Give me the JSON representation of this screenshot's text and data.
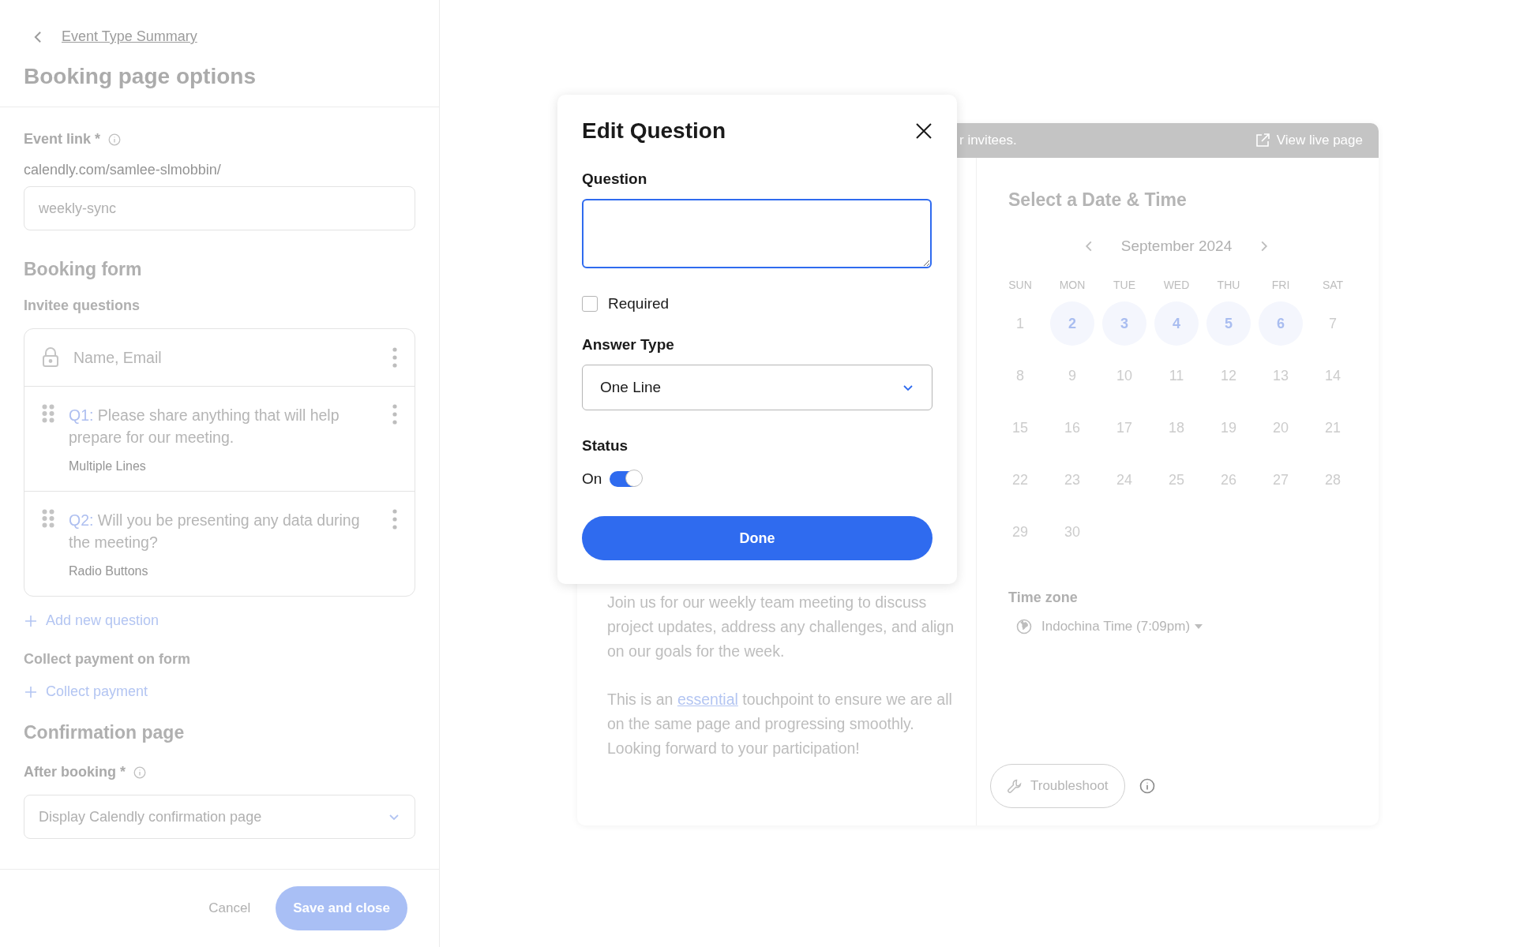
{
  "sidebar": {
    "back_link": "Event Type Summary",
    "title": "Booking page options",
    "event_link": {
      "label": "Event link *",
      "prefix": "calendly.com/samlee-slmobbin/",
      "value": "weekly-sync"
    },
    "booking_form": {
      "title": "Booking form",
      "subtitle": "Invitee questions",
      "questions": [
        {
          "kind": "locked",
          "text": "Name, Email"
        },
        {
          "kind": "custom",
          "number": "Q1:",
          "text": "Please share anything that will help prepare for our meeting.",
          "type": "Multiple Lines"
        },
        {
          "kind": "custom",
          "number": "Q2:",
          "text": "Will you be presenting any data during the meeting?",
          "type": "Radio Buttons"
        }
      ],
      "add_question": "Add new question",
      "payment_title": "Collect payment on form",
      "payment_link": "Collect payment"
    },
    "confirmation": {
      "title": "Confirmation page",
      "label": "After booking *",
      "value": "Display Calendly confirmation page"
    },
    "footer": {
      "cancel": "Cancel",
      "save": "Save and close"
    }
  },
  "preview": {
    "banner_text": "r invitees.",
    "view_live": "View live page",
    "description": {
      "paragraph": "Join us for our weekly team meeting to discuss project updates, address any challenges, and align on our goals for the week.",
      "before": "This is an ",
      "link": "essential",
      "after": " touchpoint to ensure we are all on the same page and progressing smoothly. Looking forward to your participation!"
    },
    "calendar": {
      "title": "Select a Date & Time",
      "month": "September 2024",
      "weekdays": [
        "SUN",
        "MON",
        "TUE",
        "WED",
        "THU",
        "FRI",
        "SAT"
      ],
      "days": [
        {
          "label": "1",
          "available": false
        },
        {
          "label": "2",
          "available": true
        },
        {
          "label": "3",
          "available": true
        },
        {
          "label": "4",
          "available": true
        },
        {
          "label": "5",
          "available": true
        },
        {
          "label": "6",
          "available": true
        },
        {
          "label": "7",
          "available": false
        },
        {
          "label": "8",
          "available": false
        },
        {
          "label": "9",
          "available": false
        },
        {
          "label": "10",
          "available": false
        },
        {
          "label": "11",
          "available": false
        },
        {
          "label": "12",
          "available": false
        },
        {
          "label": "13",
          "available": false
        },
        {
          "label": "14",
          "available": false
        },
        {
          "label": "15",
          "available": false
        },
        {
          "label": "16",
          "available": false
        },
        {
          "label": "17",
          "available": false
        },
        {
          "label": "18",
          "available": false
        },
        {
          "label": "19",
          "available": false
        },
        {
          "label": "20",
          "available": false
        },
        {
          "label": "21",
          "available": false
        },
        {
          "label": "22",
          "available": false
        },
        {
          "label": "23",
          "available": false
        },
        {
          "label": "24",
          "available": false
        },
        {
          "label": "25",
          "available": false
        },
        {
          "label": "26",
          "available": false
        },
        {
          "label": "27",
          "available": false
        },
        {
          "label": "28",
          "available": false
        },
        {
          "label": "29",
          "available": false
        },
        {
          "label": "30",
          "available": false
        }
      ],
      "timezone_label": "Time zone",
      "timezone": "Indochina Time (7:09pm)"
    },
    "troubleshoot": "Troubleshoot"
  },
  "modal": {
    "title": "Edit Question",
    "question_label": "Question",
    "required": {
      "label": "Required",
      "checked": false
    },
    "answer_type_label": "Answer Type",
    "answer_type": "One Line",
    "status_label": "Status",
    "status_toggle": {
      "label": "On",
      "on": true
    },
    "done": "Done"
  }
}
